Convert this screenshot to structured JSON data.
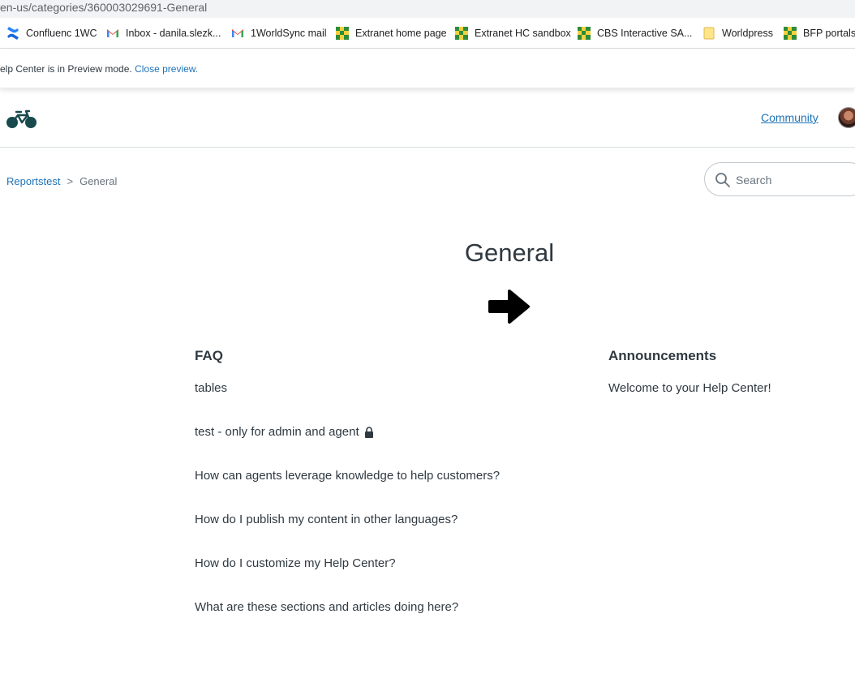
{
  "browser": {
    "url": "en-us/categories/360003029691-General",
    "bookmarks": [
      {
        "label": "Confluenc 1WC",
        "icon": "confluence-icon"
      },
      {
        "label": "Inbox - danila.slezk...",
        "icon": "gmail-icon"
      },
      {
        "label": "1WorldSync mail",
        "icon": "gmail-icon"
      },
      {
        "label": "Extranet home page",
        "icon": "green-grid-icon"
      },
      {
        "label": "Extranet HC sandbox",
        "icon": "green-grid-icon"
      },
      {
        "label": "CBS Interactive SA...",
        "icon": "green-grid-icon"
      },
      {
        "label": "Worldpress",
        "icon": "folder-icon"
      },
      {
        "label": "BFP portals",
        "icon": "green-grid-icon"
      }
    ]
  },
  "preview_banner": {
    "text": "elp Center is in Preview mode.",
    "link": "Close preview."
  },
  "header": {
    "community_link": "Community",
    "logo_icon": "bicycle-logo-icon",
    "avatar_icon": "user-avatar"
  },
  "breadcrumb": {
    "items": [
      "Reportstest",
      "General"
    ],
    "separator": ">"
  },
  "search": {
    "placeholder": "Search"
  },
  "page": {
    "title": "General"
  },
  "sections": {
    "faq": {
      "title": "FAQ",
      "articles": [
        {
          "label": "tables",
          "locked": false
        },
        {
          "label": "test - only for admin and agent",
          "locked": true
        },
        {
          "label": "How can agents leverage knowledge to help customers?",
          "locked": false
        },
        {
          "label": "How do I publish my content in other languages?",
          "locked": false
        },
        {
          "label": "How do I customize my Help Center?",
          "locked": false
        },
        {
          "label": "What are these sections and articles doing here?",
          "locked": false
        }
      ]
    },
    "announcements": {
      "title": "Announcements",
      "articles": [
        {
          "label": "Welcome to your Help Center!"
        }
      ]
    }
  },
  "colors": {
    "link": "#1f73b7",
    "text": "#2f3941",
    "muted": "#68737d"
  }
}
